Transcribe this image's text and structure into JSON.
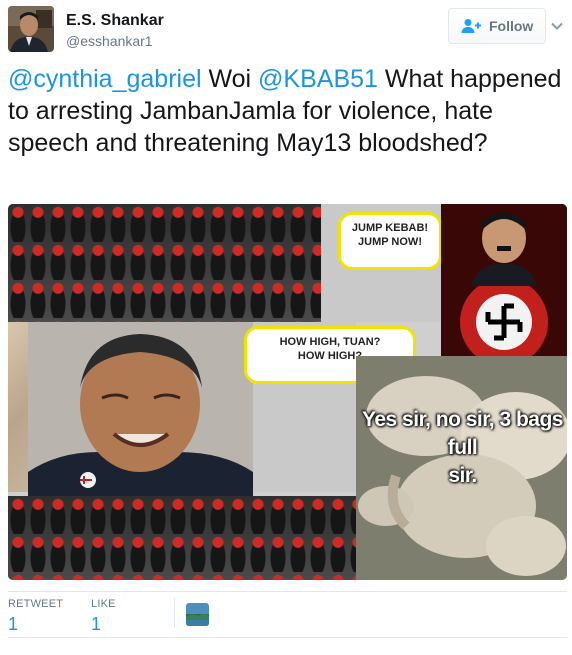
{
  "user": {
    "display_name": "E.S. Shankar",
    "handle": "@esshankar1",
    "avatar": "user-avatar-photo"
  },
  "follow_button": {
    "label": "Follow",
    "icon": "add-user-icon"
  },
  "more_icon": "chevron-down-icon",
  "tweet": {
    "mention1": "@cynthia_gabriel",
    "text1": " Woi ",
    "mention2": "@KBAB51",
    "text2": " What happened to arresting JambanJamla for violence, hate speech and threatening May13 bloodshed?"
  },
  "media": {
    "bubble1_line1": "JUMP KEBAB!",
    "bubble1_line2": "JUMP NOW!",
    "bubble2_line1": "HOW HIGH, TUAN?",
    "bubble2_line2": "HOW HIGH?",
    "caption_line1": "Yes sir, no sir, 3 bags full",
    "caption_line2": "sir.",
    "colors": {
      "bubble_border": "#f2e200",
      "police_red": "#d02a25"
    }
  },
  "stats": {
    "retweet_label": "RETWEET",
    "retweet_count": "1",
    "like_label": "LIKE",
    "like_count": "1"
  },
  "colors": {
    "link": "#1b95e0",
    "muted": "#657786",
    "text": "#14171a"
  }
}
